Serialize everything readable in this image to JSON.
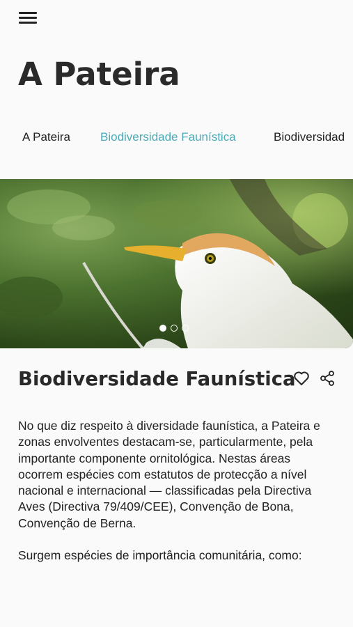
{
  "header": {
    "menu_icon": "hamburger-menu-icon",
    "title": "A Pateira"
  },
  "tabs": [
    {
      "label": "A Pateira",
      "active": false
    },
    {
      "label": "Biodiversidade Faunística",
      "active": true
    },
    {
      "label": "Biodiversidad",
      "active": false
    }
  ],
  "colors": {
    "accent": "#4aaab8",
    "text": "#222222",
    "background": "#fafafa"
  },
  "carousel": {
    "image_subject": "cattle egret among green foliage",
    "slide_count": 3,
    "active_slide": 1
  },
  "content": {
    "title": "Biodiversidade Faunística",
    "favorite_icon": "heart-outline-icon",
    "share_icon": "share-icon",
    "paragraphs": [
      "No que diz respeito à diversidade faunística, a Pateira e zonas envolventes destacam-se, particularmente, pela importante componente ornitológica. Nestas áreas ocorrem espécies com estatutos de protecção a nível nacional e internacional — classificadas pela Directiva Aves (Directiva 79/409/CEE), Convenção de Bona, Convenção de Berna.",
      "Surgem espécies de importância comunitária, como:"
    ]
  }
}
